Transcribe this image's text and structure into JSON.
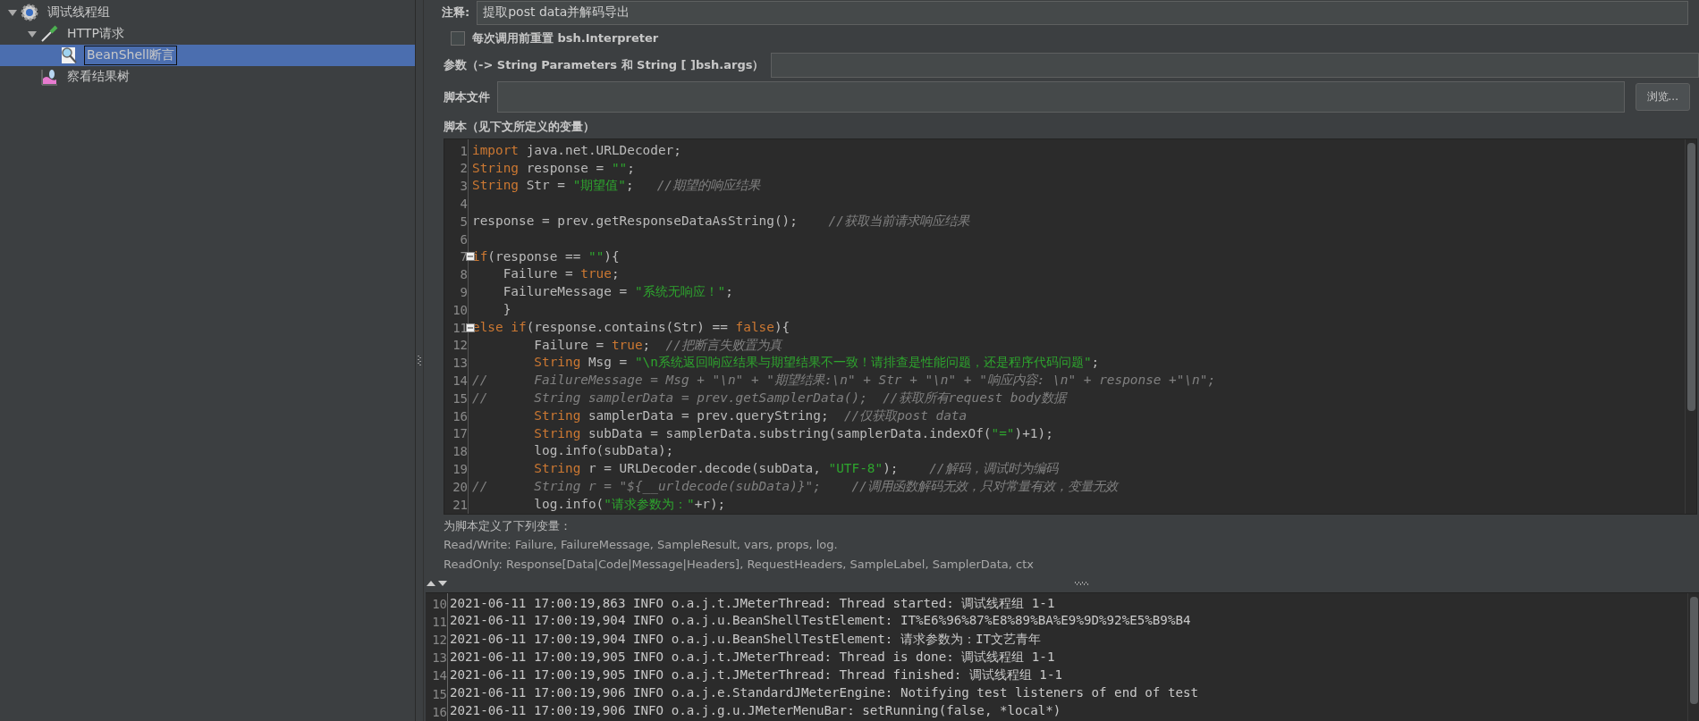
{
  "tree": [
    {
      "label": "调试线程组",
      "expanded": true,
      "selected": false,
      "children": [
        {
          "label": "HTTP请求",
          "expanded": true,
          "selected": false,
          "children": [
            {
              "label": "BeanShell断言",
              "selected": true
            }
          ]
        },
        {
          "label": "察看结果树",
          "selected": false
        }
      ]
    }
  ],
  "form": {
    "comment_label": "注释:",
    "comment_value": "提取post data并解码导出",
    "reset_checkbox": {
      "label": "每次调用前重置 bsh.Interpreter",
      "checked": false
    },
    "params_label": "参数（-> String Parameters 和 String [ ]bsh.args）",
    "file_label": "脚本文件",
    "browse_button": "浏览...",
    "script_label": "脚本（见下文所定义的变量）"
  },
  "code_lines": [
    {
      "number": "1",
      "foldable": false,
      "tokens": [
        {
          "kind": "kw",
          "text": "import"
        },
        {
          "kind": "plain",
          "text": " java.net.URLDecoder;"
        }
      ]
    },
    {
      "number": "2",
      "foldable": false,
      "tokens": [
        {
          "kind": "kw",
          "text": "String"
        },
        {
          "kind": "plain",
          "text": " response = "
        },
        {
          "kind": "str",
          "text": "\"\""
        },
        {
          "kind": "plain",
          "text": ";"
        }
      ]
    },
    {
      "number": "3",
      "foldable": false,
      "tokens": [
        {
          "kind": "kw",
          "text": "String"
        },
        {
          "kind": "plain",
          "text": " Str = "
        },
        {
          "kind": "str",
          "text": "\"期望值\""
        },
        {
          "kind": "plain",
          "text": ";   "
        },
        {
          "kind": "cmt",
          "text": "//期望的响应结果"
        }
      ]
    },
    {
      "number": "4",
      "foldable": false
    },
    {
      "number": "5",
      "foldable": false,
      "tokens": [
        {
          "kind": "plain",
          "text": "response = prev.getResponseDataAsString();    "
        },
        {
          "kind": "cmt",
          "text": "//获取当前请求响应结果"
        }
      ]
    },
    {
      "number": "6",
      "foldable": false
    },
    {
      "number": "7",
      "foldable": true,
      "tokens": [
        {
          "kind": "kw",
          "text": "if"
        },
        {
          "kind": "plain",
          "text": "(response == "
        },
        {
          "kind": "str",
          "text": "\"\""
        },
        {
          "kind": "plain",
          "text": "){"
        }
      ]
    },
    {
      "number": "8",
      "foldable": false,
      "tokens": [
        {
          "kind": "plain",
          "text": "    Failure = "
        },
        {
          "kind": "kw",
          "text": "true"
        },
        {
          "kind": "plain",
          "text": ";"
        }
      ]
    },
    {
      "number": "9",
      "foldable": false,
      "tokens": [
        {
          "kind": "plain",
          "text": "    FailureMessage = "
        },
        {
          "kind": "str",
          "text": "\"系统无响应！\""
        },
        {
          "kind": "plain",
          "text": ";"
        }
      ]
    },
    {
      "number": "10",
      "foldable": false,
      "tokens": [
        {
          "kind": "plain",
          "text": "    }"
        }
      ]
    },
    {
      "number": "11",
      "foldable": true,
      "tokens": [
        {
          "kind": "kw",
          "text": "else if"
        },
        {
          "kind": "plain",
          "text": "(response.contains(Str) == "
        },
        {
          "kind": "kw",
          "text": "false"
        },
        {
          "kind": "plain",
          "text": "){"
        }
      ]
    },
    {
      "number": "12",
      "foldable": false,
      "tokens": [
        {
          "kind": "plain",
          "text": "        Failure = "
        },
        {
          "kind": "kw",
          "text": "true"
        },
        {
          "kind": "plain",
          "text": ";  "
        },
        {
          "kind": "cmt",
          "text": "//把断言失败置为真"
        }
      ]
    },
    {
      "number": "13",
      "foldable": false,
      "tokens": [
        {
          "kind": "kw",
          "text": "        String"
        },
        {
          "kind": "plain",
          "text": " Msg = "
        },
        {
          "kind": "str",
          "text": "\"\\n系统返回响应结果与期望结果不一致！请排查是性能问题，还是程序代码问题\""
        },
        {
          "kind": "plain",
          "text": ";"
        }
      ]
    },
    {
      "number": "14",
      "foldable": false,
      "tokens": [
        {
          "kind": "cmt",
          "text": "//      FailureMessage = Msg + \"\\n\" + \"期望结果:\\n\" + Str + \"\\n\" + \"响应内容: \\n\" + response +\"\\n\";"
        }
      ]
    },
    {
      "number": "15",
      "foldable": false,
      "tokens": [
        {
          "kind": "cmt",
          "text": "//      String samplerData = prev.getSamplerData();  //获取所有request body数据"
        }
      ]
    },
    {
      "number": "16",
      "foldable": false,
      "tokens": [
        {
          "kind": "kw",
          "text": "        String"
        },
        {
          "kind": "plain",
          "text": " samplerData = prev.queryString;  "
        },
        {
          "kind": "cmt",
          "text": "//仅获取post data"
        }
      ]
    },
    {
      "number": "17",
      "foldable": false,
      "tokens": [
        {
          "kind": "kw",
          "text": "        String"
        },
        {
          "kind": "plain",
          "text": " subData = samplerData.substring(samplerData.indexOf("
        },
        {
          "kind": "str",
          "text": "\"=\""
        },
        {
          "kind": "plain",
          "text": ")+1);"
        }
      ]
    },
    {
      "number": "18",
      "foldable": false,
      "tokens": [
        {
          "kind": "plain",
          "text": "        log.info(subData);"
        }
      ]
    },
    {
      "number": "19",
      "foldable": false,
      "tokens": [
        {
          "kind": "kw",
          "text": "        String"
        },
        {
          "kind": "plain",
          "text": " r = URLDecoder.decode(subData, "
        },
        {
          "kind": "str",
          "text": "\"UTF-8\""
        },
        {
          "kind": "plain",
          "text": ");    "
        },
        {
          "kind": "cmt",
          "text": "//解码，调试时为编码"
        }
      ]
    },
    {
      "number": "20",
      "foldable": false,
      "tokens": [
        {
          "kind": "cmt",
          "text": "//      String r = \"${__urldecode(subData)}\";    //调用函数解码无效，只对常量有效，变量无效"
        }
      ]
    },
    {
      "number": "21",
      "foldable": false,
      "tokens": [
        {
          "kind": "plain",
          "text": "        log.info("
        },
        {
          "kind": "str",
          "text": "\"请求参数为：\""
        },
        {
          "kind": "plain",
          "text": "+r);"
        }
      ]
    }
  ],
  "variables": {
    "heading": "为脚本定义了下列变量：",
    "read_write": "Read/Write: Failure, FailureMessage, SampleResult, vars, props, log.",
    "read_only": "ReadOnly: Response[Data|Code|Message|Headers], RequestHeaders, SampleLabel, SamplerData, ctx"
  },
  "log_lines": [
    {
      "number": "10",
      "text": "2021-06-11 17:00:19,863 INFO o.a.j.t.JMeterThread: Thread started: 调试线程组 1-1"
    },
    {
      "number": "11",
      "text": "2021-06-11 17:00:19,904 INFO o.a.j.u.BeanShellTestElement: IT%E6%96%87%E8%89%BA%E9%9D%92%E5%B9%B4"
    },
    {
      "number": "12",
      "text": "2021-06-11 17:00:19,904 INFO o.a.j.u.BeanShellTestElement: 请求参数为：IT文艺青年"
    },
    {
      "number": "13",
      "text": "2021-06-11 17:00:19,905 INFO o.a.j.t.JMeterThread: Thread is done: 调试线程组 1-1"
    },
    {
      "number": "14",
      "text": "2021-06-11 17:00:19,905 INFO o.a.j.t.JMeterThread: Thread finished: 调试线程组 1-1"
    },
    {
      "number": "15",
      "text": "2021-06-11 17:00:19,906 INFO o.a.j.e.StandardJMeterEngine: Notifying test listeners of end of test"
    },
    {
      "number": "16",
      "text": "2021-06-11 17:00:19,906 INFO o.a.j.g.u.JMeterMenuBar: setRunning(false, *local*)"
    }
  ]
}
